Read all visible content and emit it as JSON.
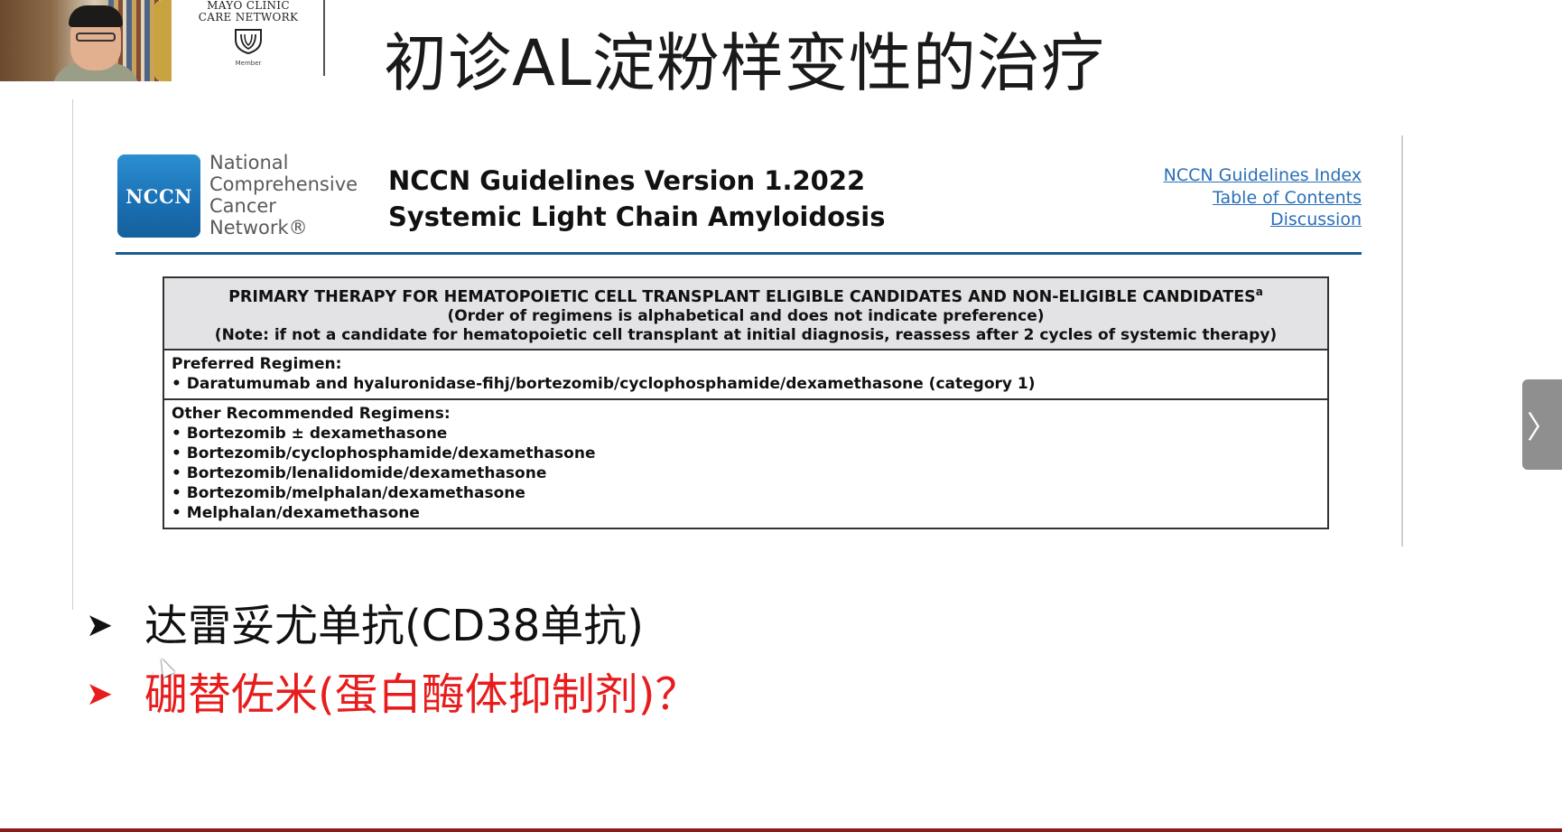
{
  "mayo": {
    "line1": "MAYO CLINIC",
    "line2": "CARE NETWORK",
    "member": "Member"
  },
  "slide": {
    "title": "初诊AL淀粉样变性的治疗"
  },
  "doc": {
    "logo_text": "NCCN",
    "org_lines": [
      "National",
      "Comprehensive",
      "Cancer",
      "Network®"
    ],
    "guideline_version": "NCCN Guidelines Version 1.2022",
    "guideline_topic": "Systemic Light Chain Amyloidosis",
    "links": [
      "NCCN Guidelines Index",
      "Table of Contents",
      "Discussion"
    ],
    "table": {
      "header_main": "PRIMARY THERAPY FOR HEMATOPOIETIC CELL TRANSPLANT ELIGIBLE CANDIDATES AND NON-ELIGIBLE CANDIDATES",
      "header_sup": "a",
      "header_note1": "(Order of regimens is alphabetical and does not indicate preference)",
      "header_note2": "(Note: if not a candidate for hematopoietic cell transplant at initial diagnosis, reassess after 2 cycles of systemic therapy)",
      "preferred_label": "Preferred Regimen:",
      "preferred_items": [
        "• Daratumumab and hyaluronidase-fihj/bortezomib/cyclophosphamide/dexamethasone (category 1)"
      ],
      "other_label": "Other Recommended Regimens:",
      "other_items": [
        "• Bortezomib ± dexamethasone",
        "• Bortezomib/cyclophosphamide/dexamethasone",
        "• Bortezomib/lenalidomide/dexamethasone",
        "• Bortezomib/melphalan/dexamethasone",
        "• Melphalan/dexamethasone"
      ]
    }
  },
  "bullets": [
    {
      "marker": "➤",
      "text": "达雷妥尤单抗(CD38单抗)",
      "color": "#111111"
    },
    {
      "marker": "➤",
      "text": "硼替佐米(蛋白酶体抑制剂)？",
      "color": "#e81c1c"
    }
  ],
  "nav": {
    "next_label": "〉"
  }
}
